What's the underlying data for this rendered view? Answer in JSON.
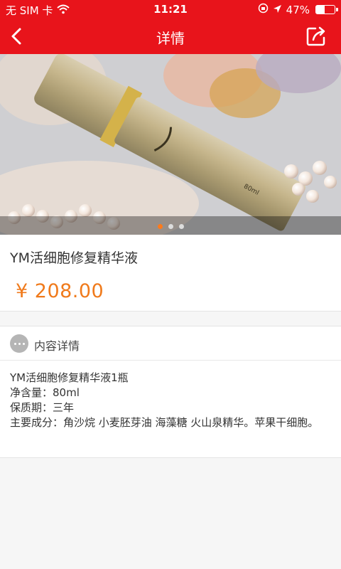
{
  "status_bar": {
    "carrier": "无 SIM 卡",
    "time": "11:21",
    "battery_percent": "47%",
    "battery_level": 0.47,
    "icons": [
      "wifi-icon",
      "lock-rotation-icon",
      "location-arrow-icon",
      "battery-icon"
    ]
  },
  "nav": {
    "title": "详情",
    "back_icon": "chevron-left-icon",
    "share_icon": "share-icon"
  },
  "banner": {
    "image": "product photo: gold bottle serum with pearls and roses",
    "page_count": 3,
    "active_page": 1
  },
  "product": {
    "title": "YM活细胞修复精华液",
    "price": "¥ 208.00"
  },
  "detail": {
    "header": "内容详情",
    "lines": [
      "YM活细胞修复精华液1瓶",
      "净含量：80ml",
      "保质期：三年",
      "主要成分：角沙烷 小麦胚芽油 海藻糖 火山泉精华。苹果干细胞。"
    ]
  },
  "colors": {
    "brand_red": "#e8141b",
    "price_orange": "#f07a1b",
    "active_dot": "#ff7a1a"
  }
}
